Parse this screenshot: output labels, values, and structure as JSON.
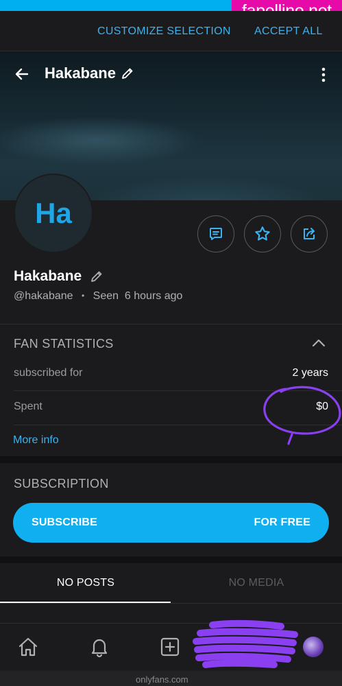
{
  "watermark": "fapellino.net",
  "cookie": {
    "customize_label": "CUSTOMIZE SELECTION",
    "accept_label": "ACCEPT ALL"
  },
  "header": {
    "title": "Hakabane"
  },
  "profile": {
    "avatar_initials": "Ha",
    "name": "Hakabane",
    "handle": "@hakabane",
    "separator": "•",
    "last_seen": "Seen  6 hours ago"
  },
  "fan_statistics": {
    "title": "FAN STATISTICS",
    "rows": [
      {
        "label": "subscribed for",
        "value": "2 years"
      },
      {
        "label": "Spent",
        "value": "$0"
      }
    ],
    "more_info": "More info"
  },
  "subscription": {
    "title": "SUBSCRIPTION",
    "button_left": "SUBSCRIBE",
    "button_right": "FOR FREE"
  },
  "tabs": [
    {
      "label": "NO POSTS",
      "active": true
    },
    {
      "label": "NO MEDIA",
      "active": false
    }
  ],
  "url_fragment": "onlyfans.com",
  "colors": {
    "accent": "#00aff0",
    "annotation": "#8a3ff0",
    "watermark_bg": "#e60ba8"
  }
}
